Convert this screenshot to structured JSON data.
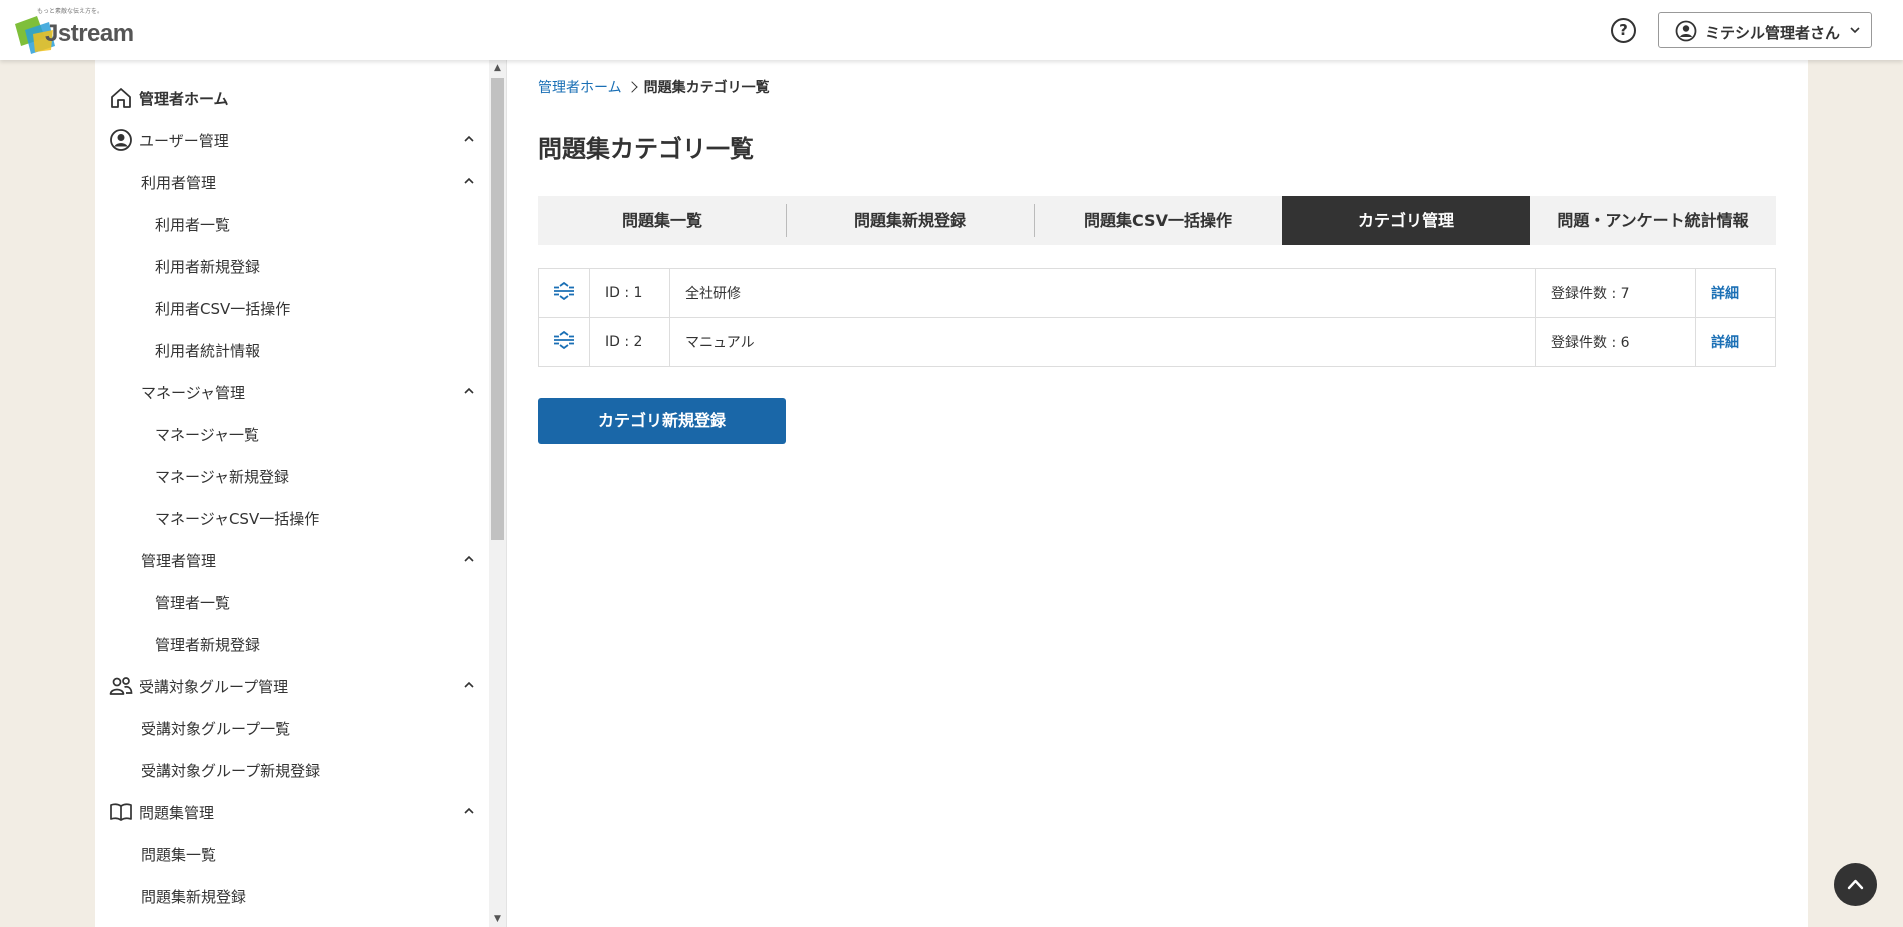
{
  "header": {
    "logo_tagline": "もっと素敵な伝え方を。",
    "logo_text": "Jstream",
    "help_symbol": "?",
    "user_name": "ミテシル管理者さん"
  },
  "sidebar": {
    "items": [
      {
        "label": "管理者ホーム",
        "level": 0,
        "icon": "home-icon"
      },
      {
        "label": "ユーザー管理",
        "level": 0,
        "icon": "user-circle-icon",
        "expanded": true
      },
      {
        "label": "利用者管理",
        "level": 1,
        "expanded": true
      },
      {
        "label": "利用者一覧",
        "level": 2
      },
      {
        "label": "利用者新規登録",
        "level": 2
      },
      {
        "label": "利用者CSV一括操作",
        "level": 2
      },
      {
        "label": "利用者統計情報",
        "level": 2
      },
      {
        "label": "マネージャ管理",
        "level": 1,
        "expanded": true
      },
      {
        "label": "マネージャ一覧",
        "level": 2
      },
      {
        "label": "マネージャ新規登録",
        "level": 2
      },
      {
        "label": "マネージャCSV一括操作",
        "level": 2
      },
      {
        "label": "管理者管理",
        "level": 1,
        "expanded": true
      },
      {
        "label": "管理者一覧",
        "level": 2
      },
      {
        "label": "管理者新規登録",
        "level": 2
      },
      {
        "label": "受講対象グループ管理",
        "level": 0,
        "icon": "group-icon",
        "expanded": true
      },
      {
        "label": "受講対象グループ一覧",
        "level": 1
      },
      {
        "label": "受講対象グループ新規登録",
        "level": 1
      },
      {
        "label": "問題集管理",
        "level": 0,
        "icon": "book-icon",
        "expanded": true
      },
      {
        "label": "問題集一覧",
        "level": 1
      },
      {
        "label": "問題集新規登録",
        "level": 1
      }
    ]
  },
  "breadcrumb": {
    "home": "管理者ホーム",
    "current": "問題集カテゴリ一覧"
  },
  "page_title": "問題集カテゴリ一覧",
  "tabs": [
    {
      "label": "問題集一覧",
      "active": false
    },
    {
      "label": "問題集新規登録",
      "active": false
    },
    {
      "label": "問題集CSV一括操作",
      "active": false
    },
    {
      "label": "カテゴリ管理",
      "active": true
    },
    {
      "label": "問題・アンケート統計情報",
      "active": false
    }
  ],
  "categories": [
    {
      "id": "ID : 1",
      "name": "全社研修",
      "count": "登録件数 : 7",
      "detail": "詳細"
    },
    {
      "id": "ID : 2",
      "name": "マニュアル",
      "count": "登録件数 : 6",
      "detail": "詳細"
    }
  ],
  "new_category_button": "カテゴリ新規登録",
  "colors": {
    "background": "#f2ede4",
    "link": "#1a6fb5",
    "primary_button": "#1a67a8",
    "active_tab": "#333333"
  }
}
